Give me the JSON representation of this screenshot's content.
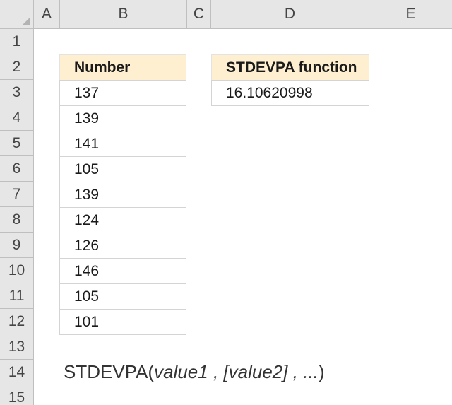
{
  "columns": [
    "A",
    "B",
    "C",
    "D",
    "E"
  ],
  "rows": [
    "1",
    "2",
    "3",
    "4",
    "5",
    "6",
    "7",
    "8",
    "9",
    "10",
    "11",
    "12",
    "13",
    "14",
    "15"
  ],
  "number_table": {
    "header": "Number",
    "values": [
      "137",
      "139",
      "141",
      "105",
      "139",
      "124",
      "126",
      "146",
      "105",
      "101"
    ]
  },
  "result_table": {
    "header": "STDEVPA function",
    "value": "16.10620998"
  },
  "syntax": {
    "function_name": "STDEVPA(",
    "args": "value1 , [value2] , ...",
    "close": ")"
  },
  "colors": {
    "header_fill": "#fdefd0",
    "grid_header_fill": "#e6e6e6"
  }
}
